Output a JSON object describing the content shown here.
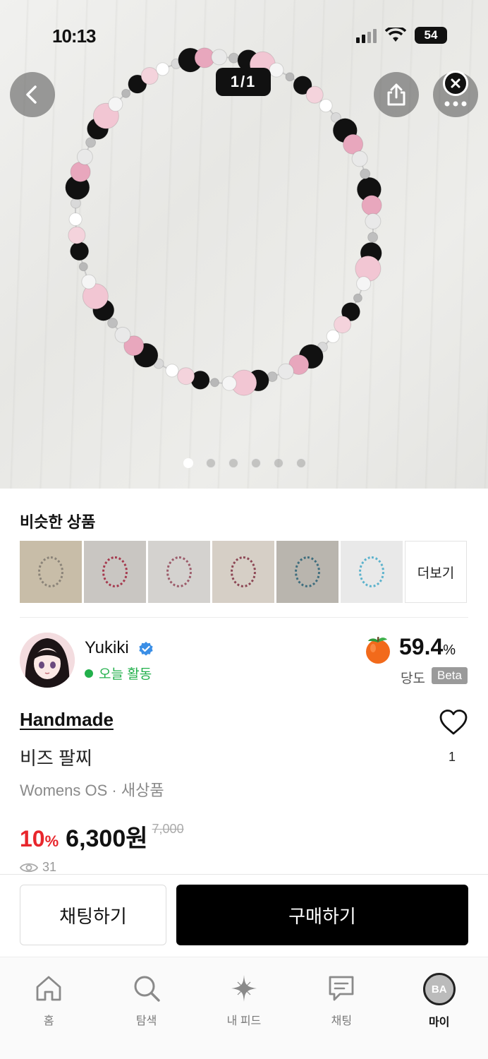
{
  "status_bar": {
    "time": "10:13",
    "battery": "54"
  },
  "gallery": {
    "counter": "1/1",
    "dots_total": 6,
    "dots_active": 1
  },
  "similar": {
    "title": "비슷한 상품",
    "more_label": "더보기",
    "thumbnails": [
      {
        "bg": "#c8bda8",
        "ring": "#8a8378"
      },
      {
        "bg": "#c9c6c2",
        "ring": "#a5384d"
      },
      {
        "bg": "#d4d2cf",
        "ring": "#9c5b6a"
      },
      {
        "bg": "#d6cfc6",
        "ring": "#8c4654"
      },
      {
        "bg": "#b9b5ae",
        "ring": "#3e6d7d"
      },
      {
        "bg": "#e9e9e9",
        "ring": "#5bb2cc"
      }
    ]
  },
  "seller": {
    "name": "Yukiki",
    "activity": "오늘 활동",
    "sweetness_value": "59.4",
    "sweetness_unit": "%",
    "sweetness_label": "당도",
    "beta": "Beta"
  },
  "product": {
    "brand": "Handmade",
    "name": "비즈 팔찌",
    "meta": "Womens OS · 새상품",
    "likes": "1",
    "discount_value": "10",
    "discount_unit": "%",
    "price": "6,300원",
    "original_price": "7,000",
    "views": "31"
  },
  "actions": {
    "chat": "채팅하기",
    "buy": "구매하기"
  },
  "tabs": [
    {
      "label": "홈",
      "icon": "home-icon"
    },
    {
      "label": "탐색",
      "icon": "search-icon"
    },
    {
      "label": "내 피드",
      "icon": "sparkle-icon"
    },
    {
      "label": "채팅",
      "icon": "chat-icon"
    },
    {
      "label": "마이",
      "icon": "avatar",
      "avatar_text": "BA"
    }
  ],
  "colors": {
    "accent_red": "#e8262c",
    "online_green": "#22b04b",
    "buy_button": "#000000"
  }
}
